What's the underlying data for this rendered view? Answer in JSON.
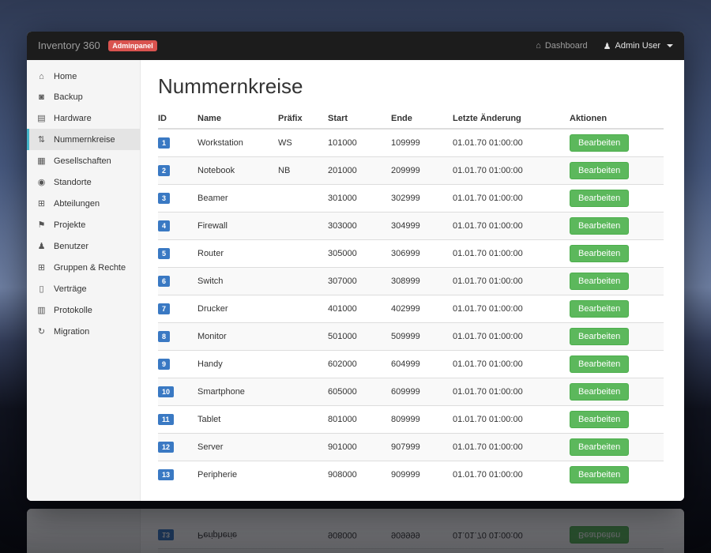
{
  "navbar": {
    "brand": "Inventory 360",
    "badge": "Adminpanel",
    "dashboard_label": "Dashboard",
    "user_label": "Admin User"
  },
  "icons": {
    "home": "⌂",
    "lock": "◙",
    "hdd": "▤",
    "sort": "⇅",
    "building": "▦",
    "map-marker": "◉",
    "grid": "⊞",
    "flag": "⚑",
    "user": "♟",
    "file": "▯",
    "file-text": "▥",
    "refresh": "↻"
  },
  "sidebar": {
    "items": [
      {
        "key": "home",
        "label": "Home",
        "icon": "home",
        "active": false
      },
      {
        "key": "backup",
        "label": "Backup",
        "icon": "lock",
        "active": false
      },
      {
        "key": "hardware",
        "label": "Hardware",
        "icon": "hdd",
        "active": false
      },
      {
        "key": "nummernkreise",
        "label": "Nummernkreise",
        "icon": "sort",
        "active": true
      },
      {
        "key": "gesellschaften",
        "label": "Gesellschaften",
        "icon": "building",
        "active": false
      },
      {
        "key": "standorte",
        "label": "Standorte",
        "icon": "map-marker",
        "active": false
      },
      {
        "key": "abteilungen",
        "label": "Abteilungen",
        "icon": "grid",
        "active": false
      },
      {
        "key": "projekte",
        "label": "Projekte",
        "icon": "flag",
        "active": false
      },
      {
        "key": "benutzer",
        "label": "Benutzer",
        "icon": "user",
        "active": false
      },
      {
        "key": "gruppen-rechte",
        "label": "Gruppen & Rechte",
        "icon": "grid",
        "active": false
      },
      {
        "key": "vertraege",
        "label": "Verträge",
        "icon": "file",
        "active": false
      },
      {
        "key": "protokolle",
        "label": "Protokolle",
        "icon": "file-text",
        "active": false
      },
      {
        "key": "migration",
        "label": "Migration",
        "icon": "refresh",
        "active": false
      }
    ]
  },
  "page": {
    "title": "Nummernkreise"
  },
  "table": {
    "headers": [
      "ID",
      "Name",
      "Präfix",
      "Start",
      "Ende",
      "Letzte Änderung",
      "Aktionen"
    ],
    "action_label": "Bearbeiten",
    "rows": [
      {
        "id": "1",
        "name": "Workstation",
        "prefix": "WS",
        "start": "101000",
        "end": "109999",
        "modified": "01.01.70 01:00:00"
      },
      {
        "id": "2",
        "name": "Notebook",
        "prefix": "NB",
        "start": "201000",
        "end": "209999",
        "modified": "01.01.70 01:00:00"
      },
      {
        "id": "3",
        "name": "Beamer",
        "prefix": "",
        "start": "301000",
        "end": "302999",
        "modified": "01.01.70 01:00:00"
      },
      {
        "id": "4",
        "name": "Firewall",
        "prefix": "",
        "start": "303000",
        "end": "304999",
        "modified": "01.01.70 01:00:00"
      },
      {
        "id": "5",
        "name": "Router",
        "prefix": "",
        "start": "305000",
        "end": "306999",
        "modified": "01.01.70 01:00:00"
      },
      {
        "id": "6",
        "name": "Switch",
        "prefix": "",
        "start": "307000",
        "end": "308999",
        "modified": "01.01.70 01:00:00"
      },
      {
        "id": "7",
        "name": "Drucker",
        "prefix": "",
        "start": "401000",
        "end": "402999",
        "modified": "01.01.70 01:00:00"
      },
      {
        "id": "8",
        "name": "Monitor",
        "prefix": "",
        "start": "501000",
        "end": "509999",
        "modified": "01.01.70 01:00:00"
      },
      {
        "id": "9",
        "name": "Handy",
        "prefix": "",
        "start": "602000",
        "end": "604999",
        "modified": "01.01.70 01:00:00"
      },
      {
        "id": "10",
        "name": "Smartphone",
        "prefix": "",
        "start": "605000",
        "end": "609999",
        "modified": "01.01.70 01:00:00"
      },
      {
        "id": "11",
        "name": "Tablet",
        "prefix": "",
        "start": "801000",
        "end": "809999",
        "modified": "01.01.70 01:00:00"
      },
      {
        "id": "12",
        "name": "Server",
        "prefix": "",
        "start": "901000",
        "end": "907999",
        "modified": "01.01.70 01:00:00"
      },
      {
        "id": "13",
        "name": "Peripherie",
        "prefix": "",
        "start": "908000",
        "end": "909999",
        "modified": "01.01.70 01:00:00"
      }
    ]
  },
  "colors": {
    "navbar_bg": "#1c1c1c",
    "badge_red": "#d9534f",
    "button_green": "#5cb85c",
    "id_badge_blue": "#3a79c3",
    "sidebar_bg": "#f5f5f5",
    "active_accent": "#45b6c9"
  }
}
